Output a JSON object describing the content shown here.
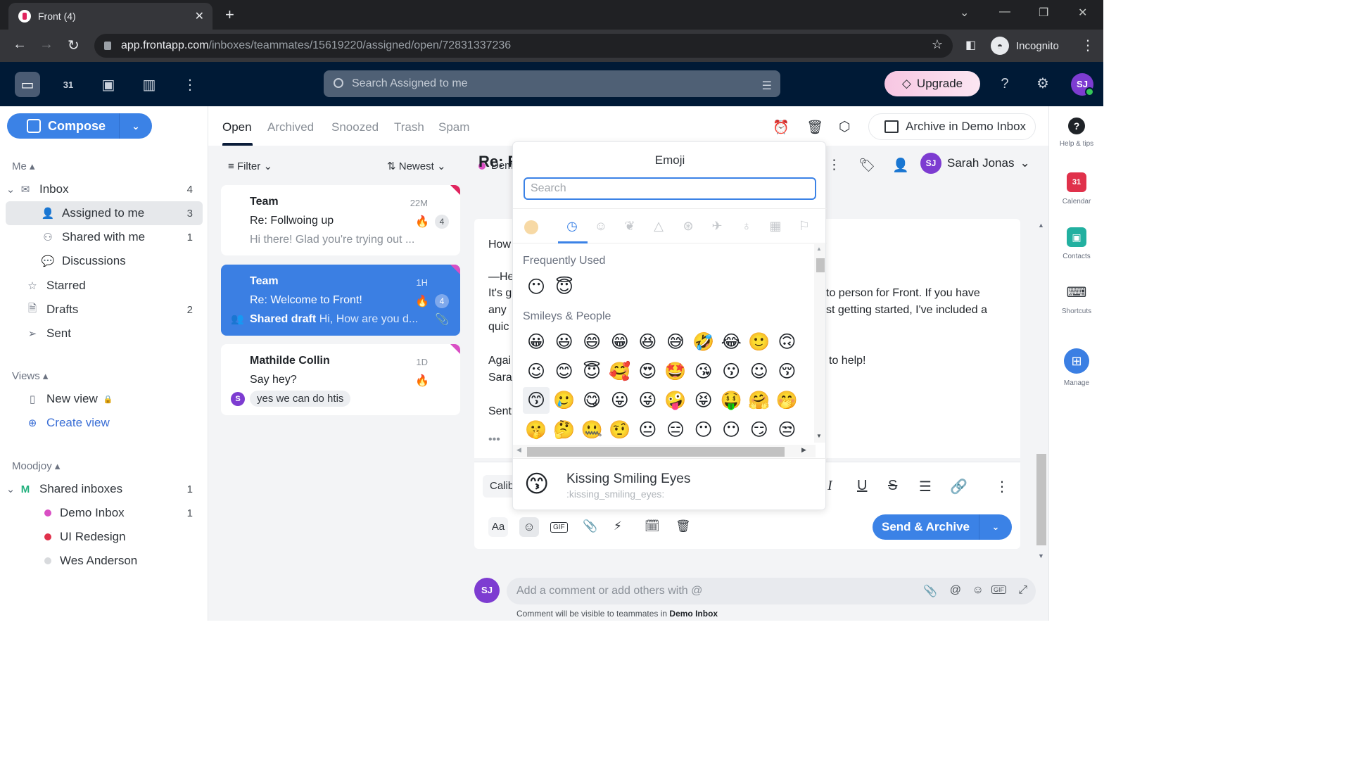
{
  "browser": {
    "tab_title": "Front (4)",
    "url_host": "app.frontapp.com",
    "url_path": "/inboxes/teammates/15619220/assigned/open/72831337236",
    "incognito_label": "Incognito"
  },
  "appnav": {
    "search_placeholder": "Search Assigned to me",
    "upgrade_label": "Upgrade",
    "user_initials": "SJ"
  },
  "sidebar": {
    "compose_label": "Compose",
    "me_section": "Me",
    "items": [
      {
        "label": "Inbox",
        "count": "4"
      },
      {
        "label": "Assigned to me",
        "count": "3"
      },
      {
        "label": "Shared with me",
        "count": "1"
      },
      {
        "label": "Discussions",
        "count": ""
      },
      {
        "label": "Starred",
        "count": ""
      },
      {
        "label": "Drafts",
        "count": "2"
      },
      {
        "label": "Sent",
        "count": ""
      }
    ],
    "views_section": "Views",
    "views": [
      {
        "label": "New view"
      },
      {
        "label": "Create view"
      }
    ],
    "team_section": "Moodjoy",
    "shared_inboxes": {
      "label": "Shared inboxes",
      "count": "1"
    },
    "inboxes": [
      {
        "label": "Demo Inbox",
        "count": "1",
        "color": "#d94fc4"
      },
      {
        "label": "UI Redesign",
        "count": "",
        "color": "#e0314b"
      },
      {
        "label": "Wes Anderson",
        "count": "",
        "color": "#d8dadd"
      }
    ]
  },
  "list": {
    "tabs": [
      "Open",
      "Archived",
      "Snoozed",
      "Trash",
      "Spam"
    ],
    "filter_label": "Filter",
    "sort_label": "Newest",
    "conversations": [
      {
        "from": "Team",
        "time": "22M",
        "subject": "Re: Follwoing up",
        "preview": "Hi there! Glad you're trying out ...",
        "badge": "4"
      },
      {
        "from": "Team",
        "time": "1H",
        "subject": "Re: Welcome to Front!",
        "draft_label": "Shared draft",
        "preview": "Hi, How are you d...",
        "badge": "4"
      },
      {
        "from": "Mathilde Collin",
        "time": "1D",
        "subject": "Say hey?",
        "comment_avatar": "S",
        "comment": "yes we can do htis"
      }
    ]
  },
  "main": {
    "archive_label": "Archive in Demo Inbox",
    "inbox_tag": "Dem",
    "title": "Re: R",
    "assignee": {
      "initials": "SJ",
      "name": "Sarah Jonas"
    },
    "body_left": [
      "How",
      "—He",
      "It's g",
      "any",
      "quic",
      "Agai",
      "Sara",
      "Sent"
    ],
    "body_right": [
      "to person for Front. If you have",
      "st getting started, I've included a",
      "to help!"
    ],
    "font_label": "Calib",
    "send_label": "Send & Archive",
    "comment_placeholder": "Add a comment or add others with @",
    "comment_note_prefix": "Comment will be visible to teammates in",
    "comment_note_inbox": "Demo Inbox"
  },
  "rail": {
    "items": [
      {
        "label": "Help & tips"
      },
      {
        "label": "Calendar"
      },
      {
        "label": "Contacts"
      },
      {
        "label": "Shortcuts"
      },
      {
        "label": "Manage"
      }
    ]
  },
  "emoji_picker": {
    "title": "Emoji",
    "search_placeholder": "Search",
    "frequently_used_label": "Frequently Used",
    "frequently_used": [
      "😶",
      "😇"
    ],
    "smileys_label": "Smileys & People",
    "smileys_rows": [
      [
        "😀",
        "😃",
        "😄",
        "😁",
        "😆",
        "😅",
        "🤣",
        "😂",
        "🙂",
        "🙃"
      ],
      [
        "😉",
        "😊",
        "😇",
        "🥰",
        "😍",
        "🤩",
        "😘",
        "😗",
        "☺",
        "😚"
      ],
      [
        "😙",
        "🥲",
        "😋",
        "😛",
        "😜",
        "🤪",
        "😝",
        "🤑",
        "🤗",
        "🤭"
      ],
      [
        "🤫",
        "🤔",
        "🤐",
        "🤨",
        "😐",
        "😑",
        "😶",
        "😶",
        "😏",
        "😒"
      ]
    ],
    "preview_emoji": "😙",
    "preview_name": "Kissing Smiling Eyes",
    "preview_code": ":kissing_smiling_eyes:"
  }
}
